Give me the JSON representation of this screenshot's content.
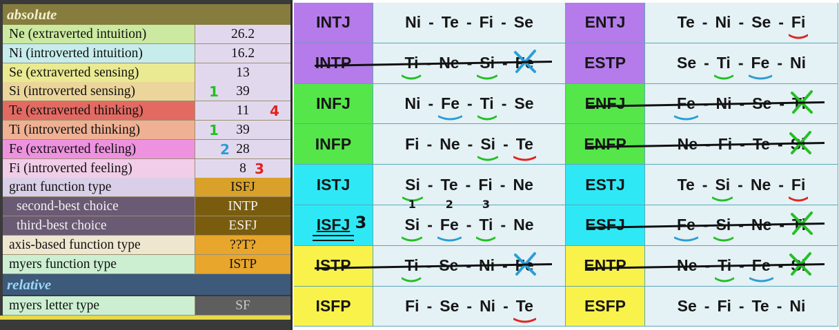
{
  "left": {
    "absolute_label": "absolute",
    "relative_label": "relative",
    "rows": [
      {
        "name": "Ne (extraverted intuition)",
        "value": "26.2",
        "name_bg": "#cbe9a0",
        "val_bg": "#e2d8ee",
        "note": ""
      },
      {
        "name": "Ni (introverted intuition)",
        "value": "16.2",
        "name_bg": "#c6ecec",
        "val_bg": "#e2d8ee",
        "note": ""
      },
      {
        "name": "Se (extraverted sensing)",
        "value": "13",
        "name_bg": "#eaea92",
        "val_bg": "#e2d8ee",
        "note": ""
      },
      {
        "name": "Si (introverted sensing)",
        "value": "39",
        "name_bg": "#ecd59a",
        "val_bg": "#e2d8ee",
        "note": "1"
      },
      {
        "name": "Te (extraverted thinking)",
        "value": "11",
        "name_bg": "#e36a62",
        "val_bg": "#e2d8ee",
        "note": "4"
      },
      {
        "name": "Ti (introverted thinking)",
        "value": "39",
        "name_bg": "#efb093",
        "val_bg": "#e2d8ee",
        "note": "1"
      },
      {
        "name": "Fe (extraverted feeling)",
        "value": "28",
        "name_bg": "#ee92e0",
        "val_bg": "#e2d8ee",
        "note": "2"
      },
      {
        "name": "Fi (introverted feeling)",
        "value": "8",
        "name_bg": "#f1cde8",
        "val_bg": "#e2d8ee",
        "note": "3"
      },
      {
        "name": "grant function type",
        "value": "ISFJ",
        "name_bg": "#d9cfe8",
        "val_bg": "#d9a129",
        "note": ""
      },
      {
        "name": "second-best choice",
        "value": "INTP",
        "name_bg": "#6a5a73",
        "val_bg": "#7a5c0f",
        "note": ""
      },
      {
        "name": "third-best choice",
        "value": "ESFJ",
        "name_bg": "#6a5a73",
        "val_bg": "#7a5c0f",
        "note": ""
      },
      {
        "name": "axis-based function type",
        "value": "??T?",
        "name_bg": "#eee6cf",
        "val_bg": "#e8a62c",
        "note": ""
      },
      {
        "name": "myers function type",
        "value": "ISTP",
        "name_bg": "#ccefd2",
        "val_bg": "#e8a62c",
        "note": ""
      }
    ],
    "relative_rows": [
      {
        "name": "myers letter type",
        "value": "SF",
        "name_bg": "#ccefd2",
        "val_bg": "#5e5e5e"
      }
    ],
    "colors": {
      "header_bg": "#857c3e",
      "header_text": "#f3efcd",
      "relative_bg": "#3d5a7a",
      "relative_text": "#9dd7f5",
      "note_green": "#22c022",
      "note_red": "#e0241f",
      "note_blue": "#2a9ed6"
    }
  },
  "table": {
    "rows": [
      {
        "left": {
          "type": "INTJ",
          "funcs": [
            "Ni",
            "Te",
            "Fi",
            "Se"
          ],
          "color": "#b57bea"
        },
        "right": {
          "type": "ENTJ",
          "funcs": [
            "Te",
            "Ni",
            "Se",
            "Fi"
          ],
          "color": "#b57bea"
        }
      },
      {
        "left": {
          "type": "INTP",
          "funcs": [
            "Ti",
            "Ne",
            "Si",
            "Fe"
          ],
          "color": "#b57bea"
        },
        "right": {
          "type": "ESTP",
          "funcs": [
            "Se",
            "Ti",
            "Fe",
            "Ni"
          ],
          "color": "#b57bea"
        }
      },
      {
        "left": {
          "type": "INFJ",
          "funcs": [
            "Ni",
            "Fe",
            "Ti",
            "Se"
          ],
          "color": "#55e64a"
        },
        "right": {
          "type": "ENFJ",
          "funcs": [
            "Fe",
            "Ni",
            "Se",
            "Ti"
          ],
          "color": "#55e64a"
        }
      },
      {
        "left": {
          "type": "INFP",
          "funcs": [
            "Fi",
            "Ne",
            "Si",
            "Te"
          ],
          "color": "#55e64a"
        },
        "right": {
          "type": "ENFP",
          "funcs": [
            "Ne",
            "Fi",
            "Te",
            "Si"
          ],
          "color": "#55e64a"
        }
      },
      {
        "left": {
          "type": "ISTJ",
          "funcs": [
            "Si",
            "Te",
            "Fi",
            "Ne"
          ],
          "color": "#2ee9f5"
        },
        "right": {
          "type": "ESTJ",
          "funcs": [
            "Te",
            "Si",
            "Ne",
            "Fi"
          ],
          "color": "#2ee9f5"
        }
      },
      {
        "left": {
          "type": "ISFJ",
          "funcs": [
            "Si",
            "Fe",
            "Ti",
            "Ne"
          ],
          "color": "#2ee9f5"
        },
        "right": {
          "type": "ESFJ",
          "funcs": [
            "Fe",
            "Si",
            "Ne",
            "Ti"
          ],
          "color": "#2ee9f5"
        }
      },
      {
        "left": {
          "type": "ISTP",
          "funcs": [
            "Ti",
            "Se",
            "Ni",
            "Fe"
          ],
          "color": "#f9f24a"
        },
        "right": {
          "type": "ENTP",
          "funcs": [
            "Ne",
            "Ti",
            "Fe",
            "Si"
          ],
          "color": "#f9f24a"
        }
      },
      {
        "left": {
          "type": "ISFP",
          "funcs": [
            "Fi",
            "Se",
            "Ni",
            "Te"
          ],
          "color": "#f9f24a"
        },
        "right": {
          "type": "ESFP",
          "funcs": [
            "Se",
            "Fi",
            "Te",
            "Ni"
          ],
          "color": "#f9f24a"
        }
      }
    ],
    "separator": "-",
    "isfj_note": "3",
    "rank_numbers": [
      "1",
      "2",
      "3"
    ]
  }
}
